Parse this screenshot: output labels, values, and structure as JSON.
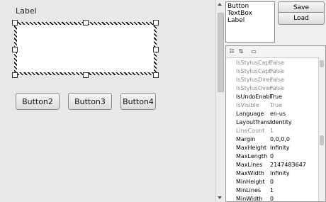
{
  "designer": {
    "label_text": "Label",
    "buttons": [
      "Button2",
      "Button3",
      "Button4"
    ]
  },
  "toolbox": {
    "items": [
      "Button",
      "TextBox",
      "Label"
    ],
    "save_label": "Save",
    "load_label": "Load"
  },
  "properties": {
    "toolbar_icons": [
      "categorize-icon",
      "sort-alpha-icon",
      "property-pages-icon"
    ],
    "rows": [
      {
        "name": "IsStylusCaptu",
        "value": "False",
        "dim": true
      },
      {
        "name": "IsStylusCaptu",
        "value": "False",
        "dim": true
      },
      {
        "name": "IsStylusDirect",
        "value": "False",
        "dim": true
      },
      {
        "name": "IsStylusOver",
        "value": "False",
        "dim": true
      },
      {
        "name": "IsUndoEnable",
        "value": "True",
        "dim": false
      },
      {
        "name": "IsVisible",
        "value": "True",
        "dim": true
      },
      {
        "name": "Language",
        "value": "en-us",
        "dim": false
      },
      {
        "name": "LayoutTransfo",
        "value": "Identity",
        "dim": false
      },
      {
        "name": "LineCount",
        "value": "1",
        "dim": true
      },
      {
        "name": "Margin",
        "value": "0,0,0,0",
        "dim": false
      },
      {
        "name": "MaxHeight",
        "value": "Infinity",
        "dim": false
      },
      {
        "name": "MaxLength",
        "value": "0",
        "dim": false
      },
      {
        "name": "MaxLines",
        "value": "2147483647",
        "dim": false
      },
      {
        "name": "MaxWidth",
        "value": "Infinity",
        "dim": false
      },
      {
        "name": "MinHeight",
        "value": "0",
        "dim": false
      },
      {
        "name": "MinLines",
        "value": "1",
        "dim": false
      },
      {
        "name": "MinWidth",
        "value": "0",
        "dim": false
      }
    ]
  }
}
